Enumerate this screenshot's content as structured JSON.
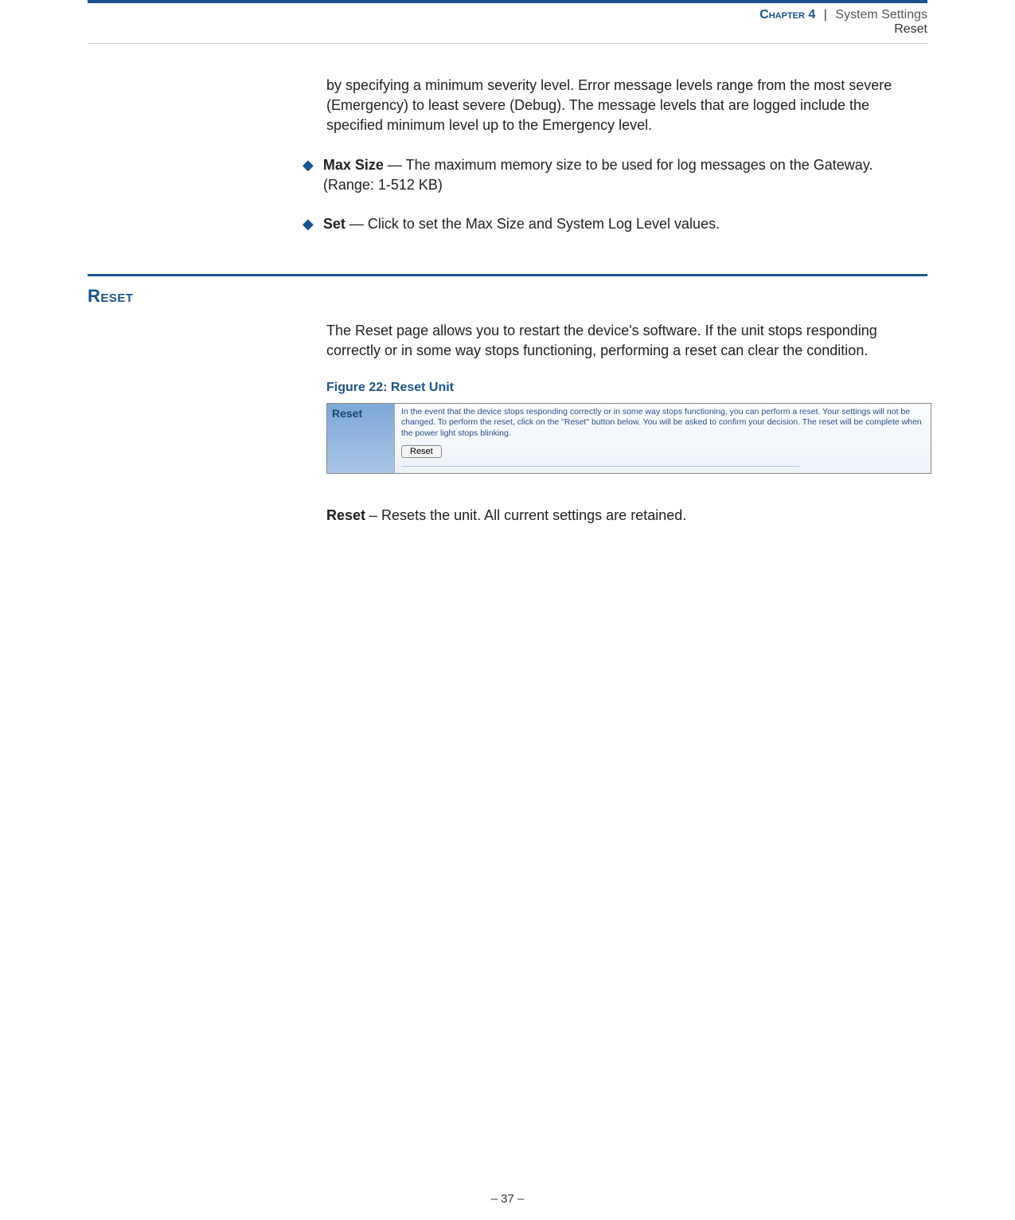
{
  "header": {
    "chapter_label": "Chapter",
    "chapter_number": "4",
    "divider": "|",
    "chapter_title": "System Settings",
    "subtitle": "Reset"
  },
  "para_intro": "by specifying a minimum severity level. Error message levels range from the most severe (Emergency) to least severe (Debug). The message levels that are logged include the specified minimum level up to the Emergency level.",
  "bullets": [
    {
      "label": "Max Size",
      "text": " — The maximum memory size to be used for log messages on the Gateway. (Range: 1-512 KB)"
    },
    {
      "label": "Set",
      "text": " — Click to set the Max Size and System Log Level values."
    }
  ],
  "reset_section": {
    "heading": "Reset",
    "intro": "The Reset page allows you to restart the device's software. If the unit stops responding correctly or in some way stops functioning, performing a reset can clear the condition.",
    "figure_caption": "Figure 22:  Reset Unit",
    "figure": {
      "side_label": "Reset",
      "description": "In the event that the device stops responding correctly or in some way stops functioning, you can perform a reset. Your settings will not be changed. To perform the reset, click on the \"Reset\" button below. You will be asked to confirm your decision. The reset will be complete when the power light stops blinking.",
      "button_label": "Reset"
    },
    "reset_item_label": "Reset",
    "reset_item_text": " – Resets the unit. All current settings are retained."
  },
  "footer": {
    "page": "–  37  –"
  }
}
